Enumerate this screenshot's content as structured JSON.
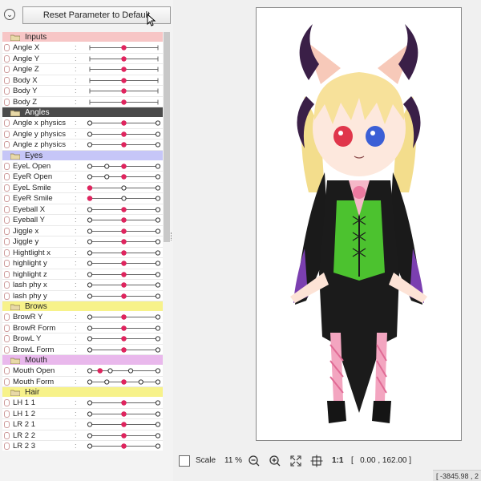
{
  "toolbar": {
    "reset_label": "Reset Parameter to Default"
  },
  "groups": [
    {
      "title": "Inputs",
      "color": "#f7c6c6",
      "params": [
        {
          "name": "Angle X",
          "type": "continuous",
          "value": 0.5
        },
        {
          "name": "Angle Y",
          "type": "continuous",
          "value": 0.5
        },
        {
          "name": "Angle Z",
          "type": "continuous",
          "value": 0.5
        },
        {
          "name": "Body X",
          "type": "continuous",
          "value": 0.5
        },
        {
          "name": "Body Y",
          "type": "continuous",
          "value": 0.5
        },
        {
          "name": "Body Z",
          "type": "continuous",
          "value": 0.5
        }
      ]
    },
    {
      "title": "Angles",
      "color": "#4a4a4a",
      "text_color": "#ffffff",
      "params": [
        {
          "name": "Angle x physics",
          "type": "keys",
          "keys": [
            0,
            0.5,
            1
          ],
          "value": 0.5
        },
        {
          "name": "Angle y physics",
          "type": "keys",
          "keys": [
            0,
            0.5,
            1
          ],
          "value": 0.5
        },
        {
          "name": "Angle z physics",
          "type": "keys",
          "keys": [
            0,
            0.5,
            1
          ],
          "value": 0.5
        }
      ]
    },
    {
      "title": "Eyes",
      "color": "#c6c6f7",
      "params": [
        {
          "name": "EyeL Open",
          "type": "keys",
          "keys": [
            0,
            0.25,
            0.5,
            1
          ],
          "value": 0.5
        },
        {
          "name": "EyeR Open",
          "type": "keys",
          "keys": [
            0,
            0.25,
            0.5,
            1
          ],
          "value": 0.5
        },
        {
          "name": "EyeL Smile",
          "type": "keys",
          "keys": [
            0,
            0.5,
            1
          ],
          "value": 0
        },
        {
          "name": "EyeR Smile",
          "type": "keys",
          "keys": [
            0,
            0.5,
            1
          ],
          "value": 0
        },
        {
          "name": "Eyeball X",
          "type": "keys",
          "keys": [
            0,
            0.5,
            1
          ],
          "value": 0.5
        },
        {
          "name": "Eyeball Y",
          "type": "keys",
          "keys": [
            0,
            0.5,
            1
          ],
          "value": 0.5
        },
        {
          "name": "Jiggle x",
          "type": "keys",
          "keys": [
            0,
            0.5,
            1
          ],
          "value": 0.5
        },
        {
          "name": "Jiggle y",
          "type": "keys",
          "keys": [
            0,
            0.5,
            1
          ],
          "value": 0.5
        },
        {
          "name": "Hightlight x",
          "type": "keys",
          "keys": [
            0,
            0.5,
            1
          ],
          "value": 0.5
        },
        {
          "name": "highlight y",
          "type": "keys",
          "keys": [
            0,
            0.5,
            1
          ],
          "value": 0.5
        },
        {
          "name": "highlight z",
          "type": "keys",
          "keys": [
            0,
            0.5,
            1
          ],
          "value": 0.5
        },
        {
          "name": "lash phy x",
          "type": "keys",
          "keys": [
            0,
            0.5,
            1
          ],
          "value": 0.5
        },
        {
          "name": "lash phy y",
          "type": "keys",
          "keys": [
            0,
            0.5,
            1
          ],
          "value": 0.5
        }
      ]
    },
    {
      "title": "Brows",
      "color": "#f7f28a",
      "params": [
        {
          "name": "BrowR Y",
          "type": "keys",
          "keys": [
            0,
            0.5,
            1
          ],
          "value": 0.5
        },
        {
          "name": "BrowR Form",
          "type": "keys",
          "keys": [
            0,
            0.5,
            1
          ],
          "value": 0.5
        },
        {
          "name": "BrowL Y",
          "type": "keys",
          "keys": [
            0,
            0.5,
            1
          ],
          "value": 0.5
        },
        {
          "name": "BrowL Form",
          "type": "keys",
          "keys": [
            0,
            0.5,
            1
          ],
          "value": 0.5
        }
      ]
    },
    {
      "title": "Mouth",
      "color": "#e9b8ec",
      "params": [
        {
          "name": "Mouth Open",
          "type": "keys",
          "keys": [
            0,
            0.15,
            0.3,
            0.6,
            1
          ],
          "value": 0.15
        },
        {
          "name": "Mouth Form",
          "type": "keys",
          "keys": [
            0,
            0.25,
            0.5,
            0.75,
            1
          ],
          "value": 0.5
        }
      ]
    },
    {
      "title": "Hair",
      "color": "#f7f28a",
      "params": [
        {
          "name": "LH 1 1",
          "type": "keys",
          "keys": [
            0,
            0.5,
            1
          ],
          "value": 0.5
        },
        {
          "name": "LH 1 2",
          "type": "keys",
          "keys": [
            0,
            0.5,
            1
          ],
          "value": 0.5
        },
        {
          "name": "LR 2 1",
          "type": "keys",
          "keys": [
            0,
            0.5,
            1
          ],
          "value": 0.5
        },
        {
          "name": "LR 2 2",
          "type": "keys",
          "keys": [
            0,
            0.5,
            1
          ],
          "value": 0.5
        },
        {
          "name": "LR 2 3",
          "type": "keys",
          "keys": [
            0,
            0.5,
            1
          ],
          "value": 0.5
        }
      ]
    }
  ],
  "bottom": {
    "scale_label": "Scale",
    "zoom": "11 %",
    "actual_size_label": "1:1",
    "coords": "[   0.00 , 162.00 ]"
  },
  "status": {
    "cursor_coords": "[ -3845.98 , 2"
  },
  "colors": {
    "value_dot": "#e0245e",
    "key_dot": "#333333",
    "accent_cape": "#7b3fb0",
    "vest": "#4cc22f"
  },
  "icons": {
    "collapse": "chevron-down-icon",
    "folder": "folder-icon",
    "zoom_out": "zoom-out-icon",
    "zoom_in": "zoom-in-icon",
    "fit": "fit-screen-icon",
    "center": "crosshair-icon"
  }
}
